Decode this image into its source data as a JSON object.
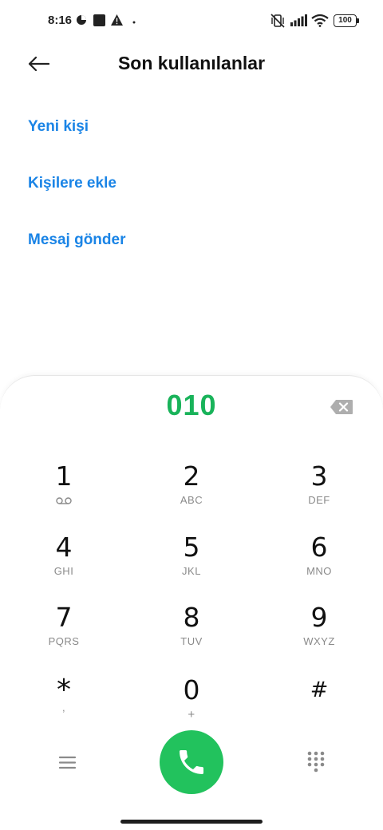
{
  "status": {
    "time": "8:16",
    "battery": "100"
  },
  "header": {
    "title": "Son kullanılanlar"
  },
  "actions": [
    {
      "label": "Yeni kişi"
    },
    {
      "label": "Kişilere ekle"
    },
    {
      "label": "Mesaj gönder"
    }
  ],
  "dialer": {
    "number": "010",
    "keys": [
      {
        "digit": "1",
        "letters": ""
      },
      {
        "digit": "2",
        "letters": "ABC"
      },
      {
        "digit": "3",
        "letters": "DEF"
      },
      {
        "digit": "4",
        "letters": "GHI"
      },
      {
        "digit": "5",
        "letters": "JKL"
      },
      {
        "digit": "6",
        "letters": "MNO"
      },
      {
        "digit": "7",
        "letters": "PQRS"
      },
      {
        "digit": "8",
        "letters": "TUV"
      },
      {
        "digit": "9",
        "letters": "WXYZ"
      },
      {
        "digit": "*",
        "letters": ","
      },
      {
        "digit": "0",
        "letters": "+"
      },
      {
        "digit": "#",
        "letters": ""
      }
    ]
  },
  "colors": {
    "accent_blue": "#1a84e6",
    "dial_green": "#19b35a",
    "call_green": "#22c25d"
  },
  "icons": {
    "back": "arrow-left-icon",
    "backspace": "backspace-icon",
    "menu": "menu-icon",
    "call": "phone-icon",
    "keypad": "dialpad-icon",
    "voicemail": "voicemail-icon"
  }
}
